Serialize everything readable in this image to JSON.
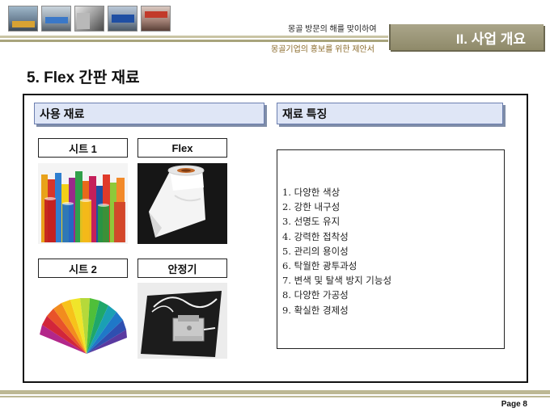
{
  "header": {
    "tagline": "몽골 방문의 해를 맞이하여",
    "subtitle": "몽골기업의 홍보를 위한 제안서",
    "section_badge": "II. 사업 개요",
    "thumbnails": [
      "storefront-sign-photo",
      "building-sign-photo",
      "billboard-photo",
      "bank-sign-photo",
      "shop-sign-photo"
    ]
  },
  "title": "5. Flex 간판 재료",
  "left_panel": {
    "heading": "사용 재료",
    "materials": [
      {
        "label": "시트 1",
        "image": "colored-sheet-rolls"
      },
      {
        "label": "Flex",
        "image": "flex-fabric-roll"
      },
      {
        "label": "시트 2",
        "image": "color-fan-swatch"
      },
      {
        "label": "안정기",
        "image": "ballast-device"
      }
    ]
  },
  "right_panel": {
    "heading": "재료 특징",
    "features": [
      "1. 다양한 색상",
      "2. 강한 내구성",
      "3. 선명도 유지",
      "4. 강력한 접착성",
      "5. 관리의 용이성",
      "6. 탁월한 광투과성",
      "7. 변색 및 탈색 방지 기능성",
      "8. 다양한 가공성",
      "9. 확실한 경제성"
    ]
  },
  "footer": {
    "page": "Page 8"
  },
  "colors": {
    "accent": "#8f8a6a",
    "header_line": "#bdb894",
    "section_head_bg": "#dfe6f6",
    "subtitle_text": "#8a6a2a"
  }
}
